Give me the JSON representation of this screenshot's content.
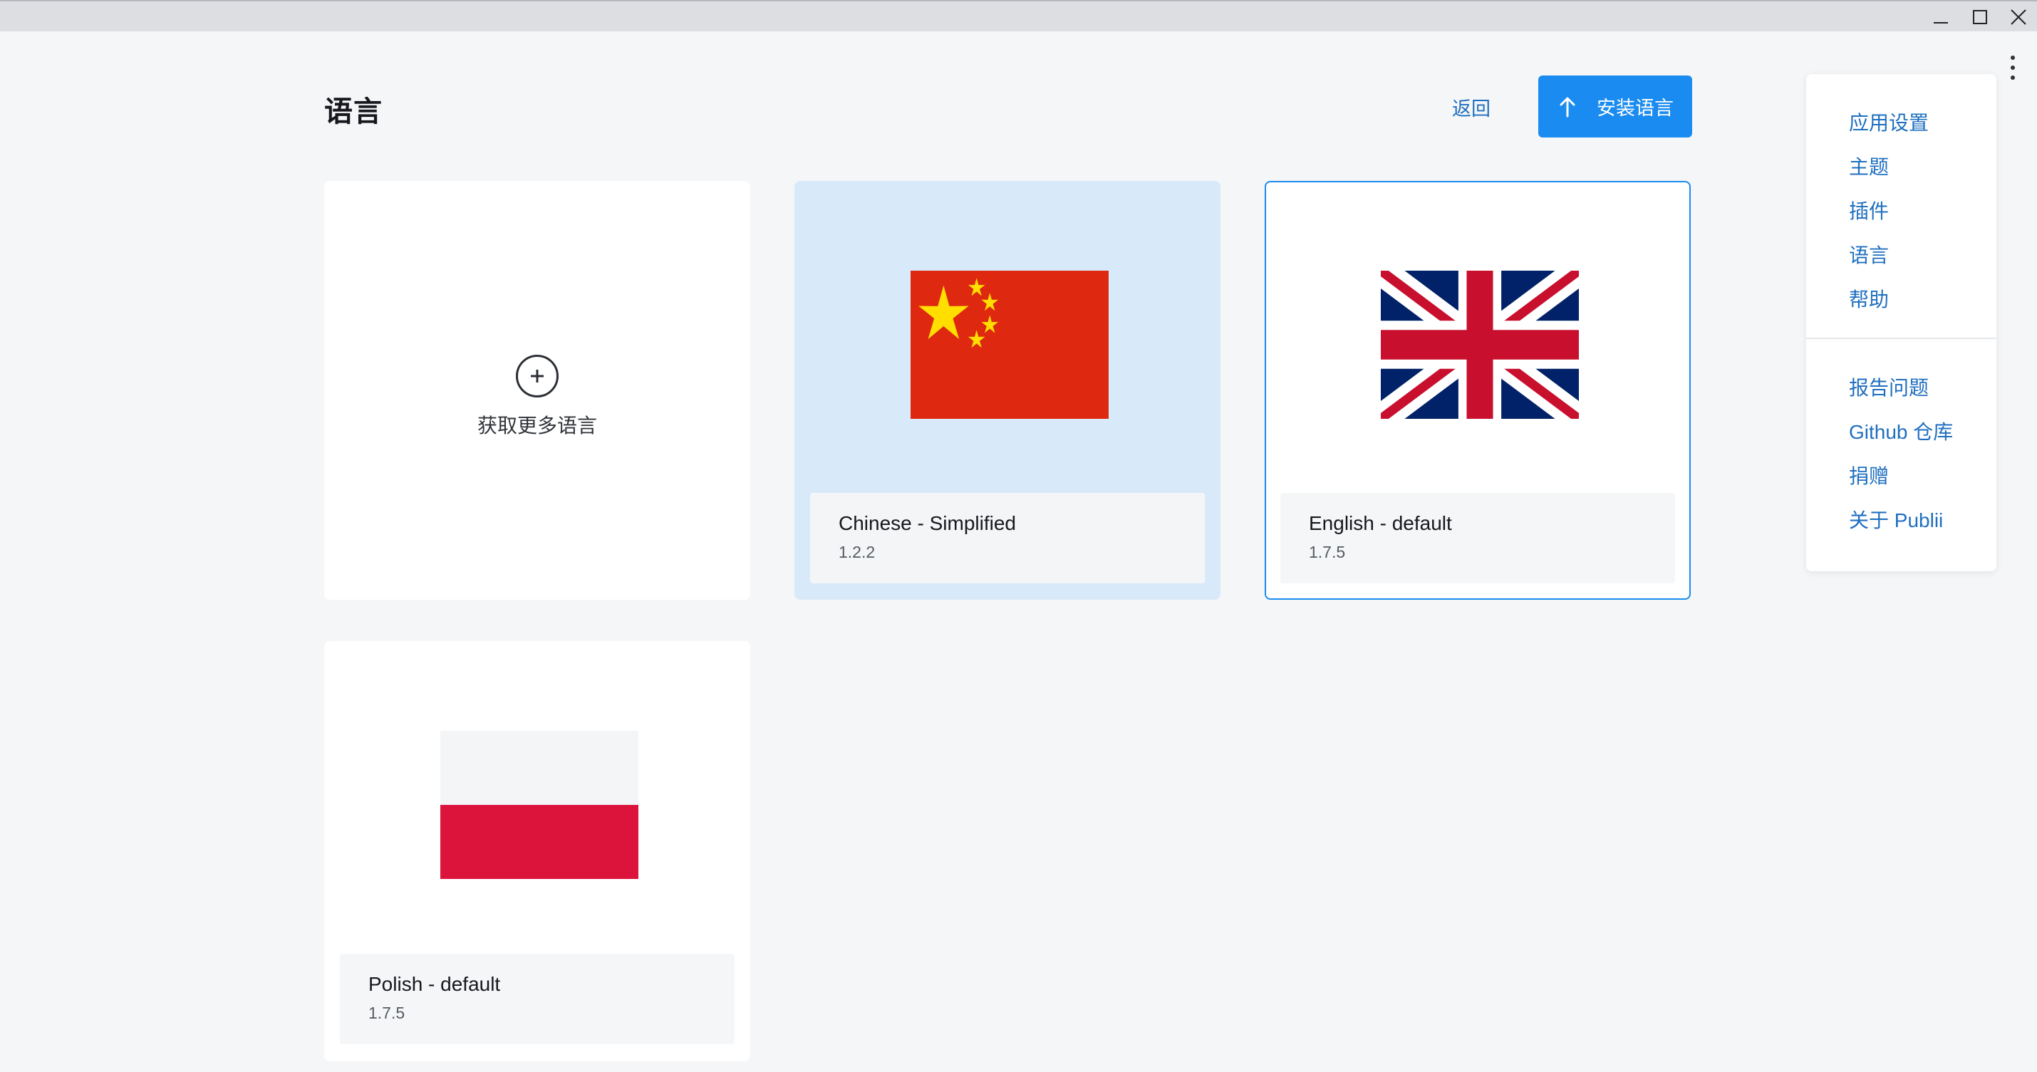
{
  "page": {
    "title": "语言"
  },
  "header": {
    "back_label": "返回",
    "install_label": "安装语言"
  },
  "get_more": {
    "label": "获取更多语言"
  },
  "languages": [
    {
      "name": "Chinese - Simplified",
      "version": "1.2.2",
      "flag": "china-flag",
      "state": "active"
    },
    {
      "name": "English - default",
      "version": "1.7.5",
      "flag": "uk-flag",
      "state": "selected"
    },
    {
      "name": "Polish - default",
      "version": "1.7.5",
      "flag": "poland-flag",
      "state": "normal"
    }
  ],
  "menu": {
    "items": [
      "应用设置",
      "主题",
      "插件",
      "语言",
      "帮助"
    ],
    "links": [
      "报告问题",
      "Github 仓库",
      "捐赠",
      "关于 Publii"
    ]
  },
  "colors": {
    "accent": "#1a8bf0",
    "link": "#1f6fbf",
    "active_card": "#d8eafa",
    "background": "#f5f6f8"
  }
}
